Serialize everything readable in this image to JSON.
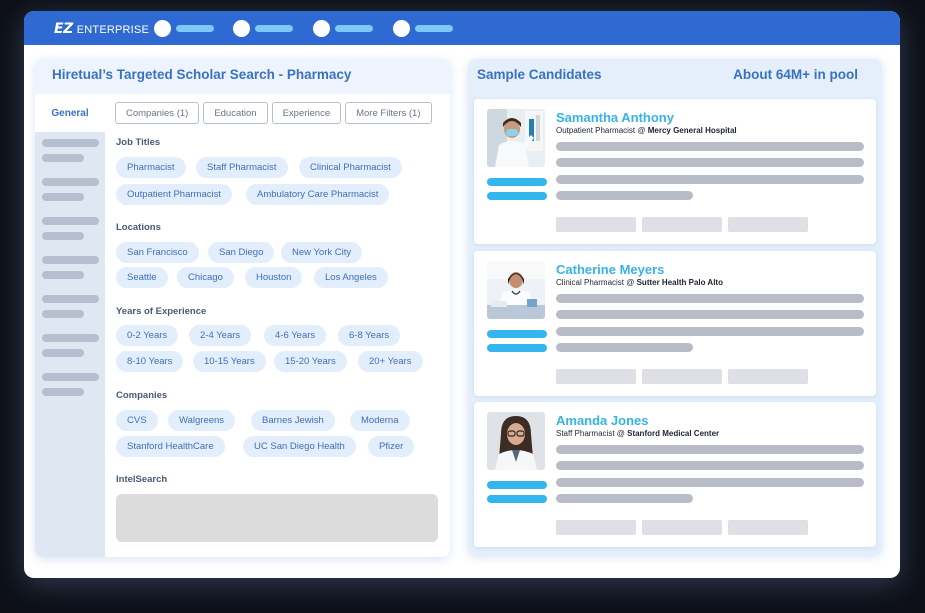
{
  "app": {
    "logo_mark": "EZ",
    "logo_text": "ENTERPRISE",
    "brand_color": "#2e6ad1",
    "accent_color": "#36b3e8"
  },
  "search_panel": {
    "title": "Hiretual’s Targeted Scholar Search - Pharmacy",
    "sidebar_active": "General",
    "tabs": [
      "Companies (1)",
      "Education",
      "Experience",
      "More Filters (1)"
    ],
    "sections": {
      "job_titles": {
        "label": "Job Titles",
        "chips": [
          "Pharmacist",
          "Staff Pharmacist",
          "Clinical Pharmacist",
          "Outpatient Pharmacist",
          "Ambulatory Care Pharmacist"
        ]
      },
      "locations": {
        "label": "Locations",
        "chips": [
          "San Francisco",
          "San Diego",
          "New York City",
          "Seattle",
          "Chicago",
          "Houston",
          "Los Angeles"
        ]
      },
      "experience": {
        "label": "Years of Experience",
        "chips": [
          "0-2 Years",
          "2-4 Years",
          "4-6 Years",
          "6-8 Years",
          "8-10 Years",
          "10-15 Years",
          "15-20 Years",
          "20+ Years"
        ]
      },
      "companies": {
        "label": "Companies",
        "chips": [
          "CVS",
          "Walgreens",
          "Barnes Jewish",
          "Moderna",
          "Stanford HealthCare",
          "UC San Diego Health",
          "Pfizer"
        ]
      },
      "intelsearch": {
        "label": "IntelSearch"
      }
    }
  },
  "candidates_panel": {
    "title": "Sample Candidates",
    "pool": "About 64M+ in pool",
    "candidates": [
      {
        "name": "Samantha Anthony",
        "role": "Outpatient Pharmacist @ ",
        "org": "Mercy General Hospital"
      },
      {
        "name": "Catherine Meyers",
        "role": "Clinical Pharmacist @ ",
        "org": "Sutter Health Palo Alto"
      },
      {
        "name": "Amanda Jones",
        "role": "Staff Pharmacist @ ",
        "org": "Stanford Medical Center"
      }
    ]
  }
}
